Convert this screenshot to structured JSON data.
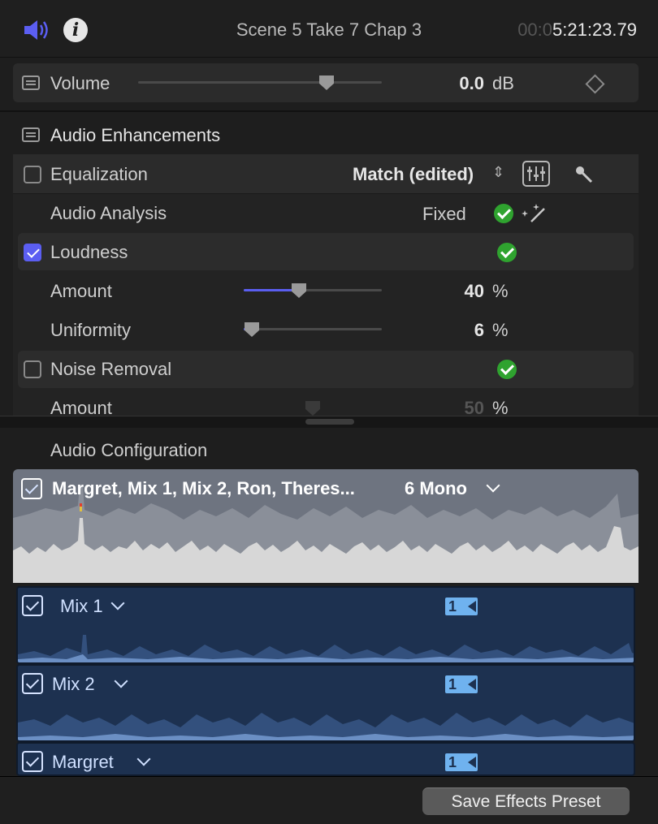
{
  "header": {
    "scene_title": "Scene 5 Take 7 Chap 3",
    "timecode_dim": "00:0",
    "timecode": "5:21:23.79"
  },
  "volume": {
    "label": "Volume",
    "value": "0.0",
    "unit": "dB",
    "level": 0.78
  },
  "enhancements": {
    "title": "Audio Enhancements",
    "equalization": {
      "label": "Equalization",
      "preset": "Match (edited)"
    },
    "analysis": {
      "label": "Audio Analysis",
      "status": "Fixed"
    },
    "loudness": {
      "label": "Loudness",
      "amount": {
        "label": "Amount",
        "value": "40",
        "unit": "%",
        "level": 0.4
      },
      "uniformity": {
        "label": "Uniformity",
        "value": "6",
        "unit": "%",
        "level": 0.06
      }
    },
    "noise": {
      "label": "Noise Removal",
      "amount": {
        "label": "Amount",
        "value": "50",
        "unit": "%"
      }
    }
  },
  "configuration": {
    "title": "Audio Configuration",
    "master": {
      "name": "Margret, Mix 1, Mix 2, Ron, Theres...",
      "format": "6 Mono"
    },
    "lanes": [
      {
        "name": "Mix 1",
        "badge": "1"
      },
      {
        "name": "Mix 2",
        "badge": "1"
      },
      {
        "name": "Margret",
        "badge": "1"
      }
    ]
  },
  "footer": {
    "save_preset": "Save Effects Preset"
  },
  "colors": {
    "accent": "#5b5ef2",
    "ok": "#2fa32f",
    "lane": "#1d3150",
    "badge": "#6fb2ef"
  }
}
